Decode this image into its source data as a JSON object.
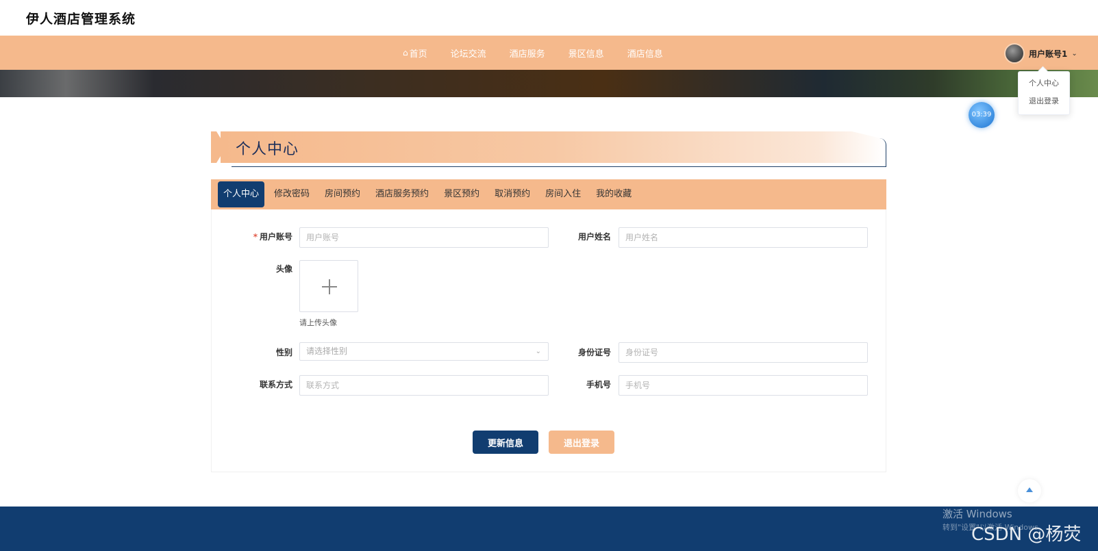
{
  "brand": {
    "title": "伊人酒店管理系统"
  },
  "nav": {
    "items": [
      {
        "label": "首页"
      },
      {
        "label": "论坛交流"
      },
      {
        "label": "酒店服务"
      },
      {
        "label": "景区信息"
      },
      {
        "label": "酒店信息"
      }
    ],
    "user_name": "用户账号1"
  },
  "dropdown": {
    "items": [
      "个人中心",
      "退出登录"
    ]
  },
  "timer": "03:39",
  "section": {
    "title": "个人中心"
  },
  "tabs": [
    {
      "label": "个人中心",
      "active": true
    },
    {
      "label": "修改密码"
    },
    {
      "label": "房间预约"
    },
    {
      "label": "酒店服务预约"
    },
    {
      "label": "景区预约"
    },
    {
      "label": "取消预约"
    },
    {
      "label": "房间入住"
    },
    {
      "label": "我的收藏"
    }
  ],
  "form": {
    "account": {
      "label": "用户账号",
      "placeholder": "用户账号",
      "required": "*"
    },
    "name": {
      "label": "用户姓名",
      "placeholder": "用户姓名"
    },
    "avatar": {
      "label": "头像",
      "hint": "请上传头像"
    },
    "gender": {
      "label": "性别",
      "placeholder": "请选择性别"
    },
    "id_card": {
      "label": "身份证号",
      "placeholder": "身份证号"
    },
    "contact": {
      "label": "联系方式",
      "placeholder": "联系方式"
    },
    "phone": {
      "label": "手机号",
      "placeholder": "手机号"
    }
  },
  "buttons": {
    "update": "更新信息",
    "logout": "退出登录"
  },
  "watermark": {
    "activate": "激活 Windows",
    "hint": "转到\"设置\"以激活 Windows。",
    "csdn": "CSDN @杨荧"
  },
  "colors": {
    "accent": "#f5b98c",
    "primary": "#113d70"
  }
}
